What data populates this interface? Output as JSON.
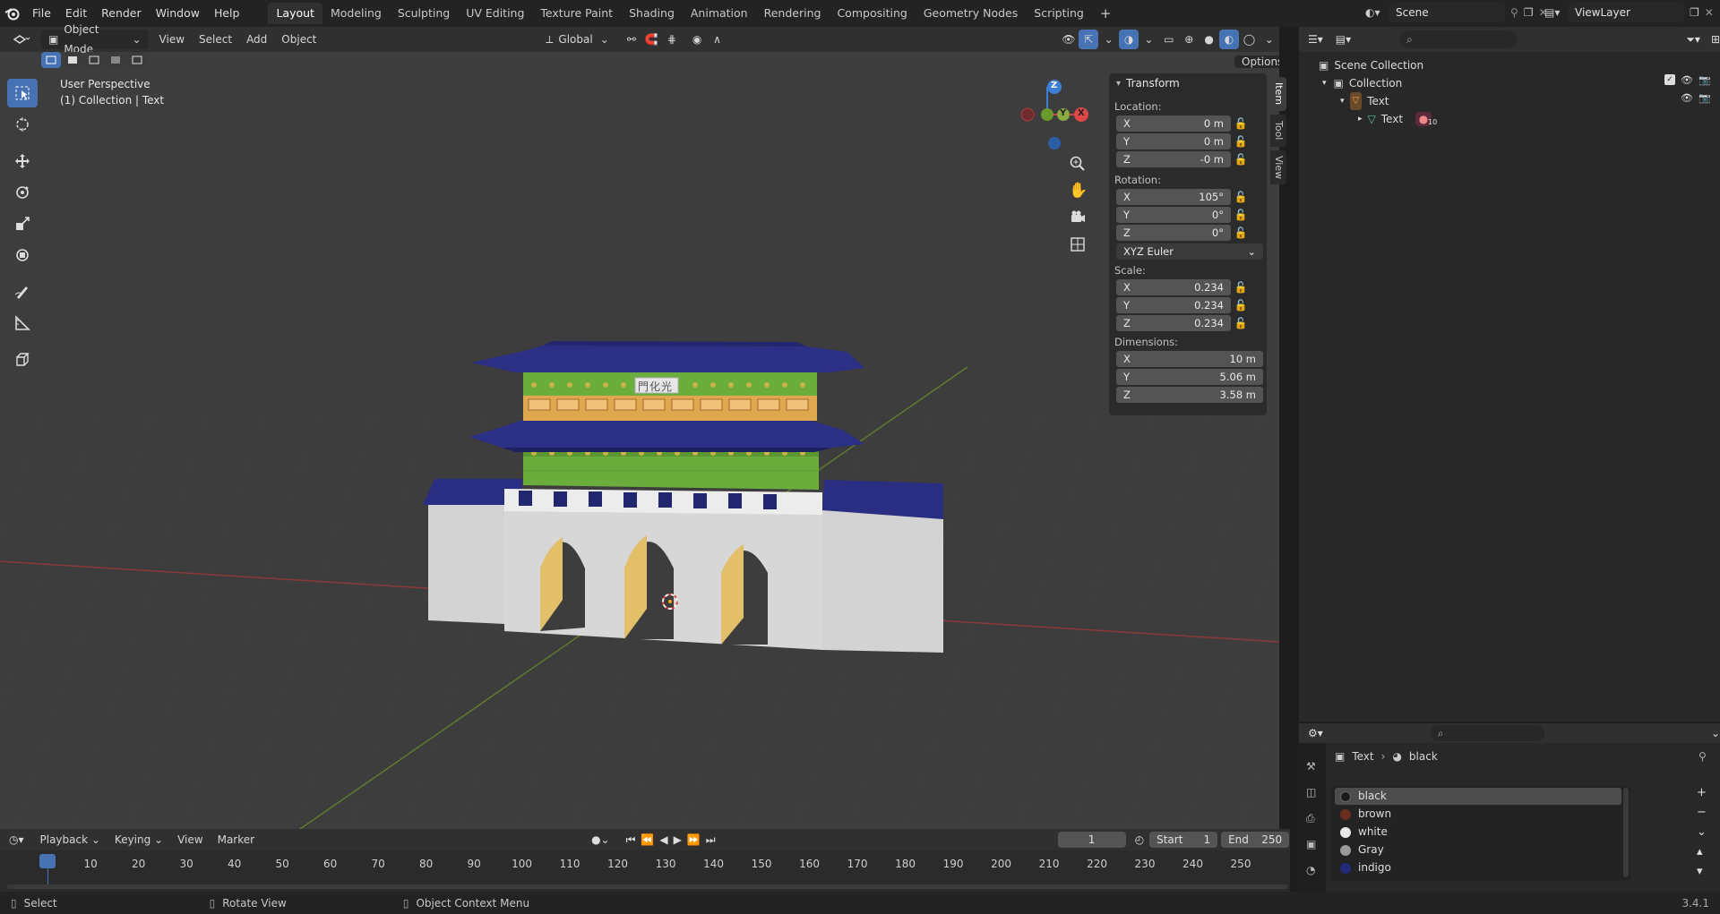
{
  "top_menu": [
    "File",
    "Edit",
    "Render",
    "Window",
    "Help"
  ],
  "workspace_tabs": [
    "Layout",
    "Modeling",
    "Sculpting",
    "UV Editing",
    "Texture Paint",
    "Shading",
    "Animation",
    "Rendering",
    "Compositing",
    "Geometry Nodes",
    "Scripting"
  ],
  "active_workspace": "Layout",
  "scene_name": "Scene",
  "view_layer": "ViewLayer",
  "viewport_header": {
    "mode": "Object Mode",
    "menus": [
      "View",
      "Select",
      "Add",
      "Object"
    ],
    "orientation": "Global",
    "options": "Options"
  },
  "viewport_overlay": {
    "view_name": "User Perspective",
    "collection_info": "(1) Collection | Text",
    "gizmo_axes": [
      "Z",
      "Y",
      "X"
    ],
    "sign_text": "門化光"
  },
  "npanel": {
    "title": "Transform",
    "location_label": "Location:",
    "location": [
      {
        "axis": "X",
        "value": "0 m"
      },
      {
        "axis": "Y",
        "value": "0 m"
      },
      {
        "axis": "Z",
        "value": "-0 m"
      }
    ],
    "rotation_label": "Rotation:",
    "rotation": [
      {
        "axis": "X",
        "value": "105°"
      },
      {
        "axis": "Y",
        "value": "0°"
      },
      {
        "axis": "Z",
        "value": "0°"
      }
    ],
    "rotation_mode": "XYZ Euler",
    "scale_label": "Scale:",
    "scale": [
      {
        "axis": "X",
        "value": "0.234"
      },
      {
        "axis": "Y",
        "value": "0.234"
      },
      {
        "axis": "Z",
        "value": "0.234"
      }
    ],
    "dimensions_label": "Dimensions:",
    "dimensions": [
      {
        "axis": "X",
        "value": "10 m"
      },
      {
        "axis": "Y",
        "value": "5.06 m"
      },
      {
        "axis": "Z",
        "value": "3.58 m"
      }
    ]
  },
  "side_tabs": [
    "Item",
    "Tool",
    "View"
  ],
  "outliner": {
    "scene_collection": "Scene Collection",
    "collection": "Collection",
    "object": "Text",
    "data": "Text",
    "material_badge": "10"
  },
  "properties": {
    "breadcrumb_object": "Text",
    "breadcrumb_material": "black",
    "materials": [
      {
        "name": "black",
        "color": "#1a1a1a"
      },
      {
        "name": "brown",
        "color": "#6b2e1e"
      },
      {
        "name": "white",
        "color": "#e8e8e8"
      },
      {
        "name": "Gray",
        "color": "#9a9a9a"
      },
      {
        "name": "indigo",
        "color": "#232a7a"
      }
    ],
    "selected_material": "black"
  },
  "timeline": {
    "menus": [
      "Playback",
      "Keying",
      "View",
      "Marker"
    ],
    "current_frame": "1",
    "start_label": "Start",
    "start": "1",
    "end_label": "End",
    "end": "250",
    "ticks": [
      "1",
      "10",
      "20",
      "30",
      "40",
      "50",
      "60",
      "70",
      "80",
      "90",
      "100",
      "110",
      "120",
      "130",
      "140",
      "150",
      "160",
      "170",
      "180",
      "190",
      "200",
      "210",
      "220",
      "230",
      "240",
      "250"
    ]
  },
  "statusbar": {
    "select": "Select",
    "rotate": "Rotate View",
    "context": "Object Context Menu",
    "version": "3.4.1"
  },
  "colors": {
    "accent": "#4772b3",
    "roof": "#2b2e80",
    "green": "#6cae3e",
    "wall": "#d5d5d5",
    "arch": "#e2bf6a"
  }
}
